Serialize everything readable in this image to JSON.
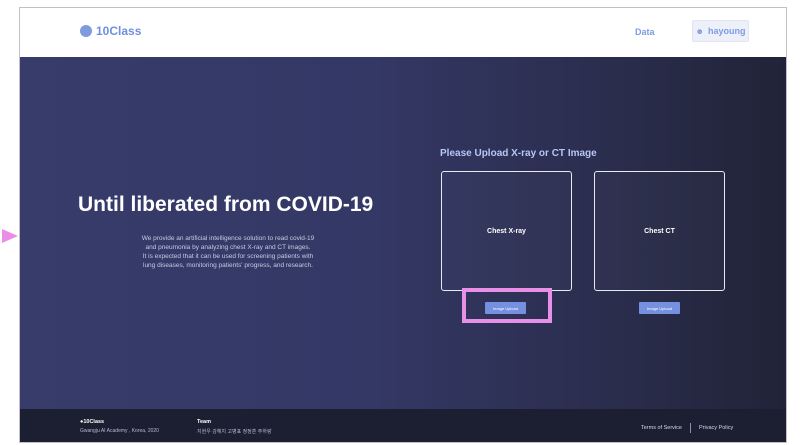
{
  "header": {
    "logo_text": "10Class",
    "nav_data": "Data",
    "user_label": "hayoung",
    "user_icon": "user-icon"
  },
  "hero": {
    "title": "Until liberated from COVID-19",
    "description_lines": [
      "We provide an artificial intelligence solution to read covid-19",
      "and pneumonia by analyzing chest X-ray and CT images.",
      "It is expected that it can be used for screening patients with",
      "lung diseases, monitoring patients' progress, and research."
    ],
    "upload_heading": "Please Upload X-ray or CT Image",
    "cards": [
      {
        "label": "Chest X-ray",
        "button": "Image Upload"
      },
      {
        "label": "Chest CT",
        "button": "Image Upload"
      }
    ]
  },
  "footer": {
    "brand": "●10Class",
    "address": "Gwangju AI Academy , Korea, 2020",
    "team_label": "Team",
    "team_members": "지현우  강혜지  고병표  정정훈  주하랑",
    "terms": "Terms of Service",
    "privacy": "Privacy Policy"
  },
  "colors": {
    "accent": "#7590df",
    "hero_bg_start": "#373c6b",
    "hero_bg_end": "#212338",
    "footer_bg": "#1c1e31",
    "annotation": "#ea8ce8"
  }
}
